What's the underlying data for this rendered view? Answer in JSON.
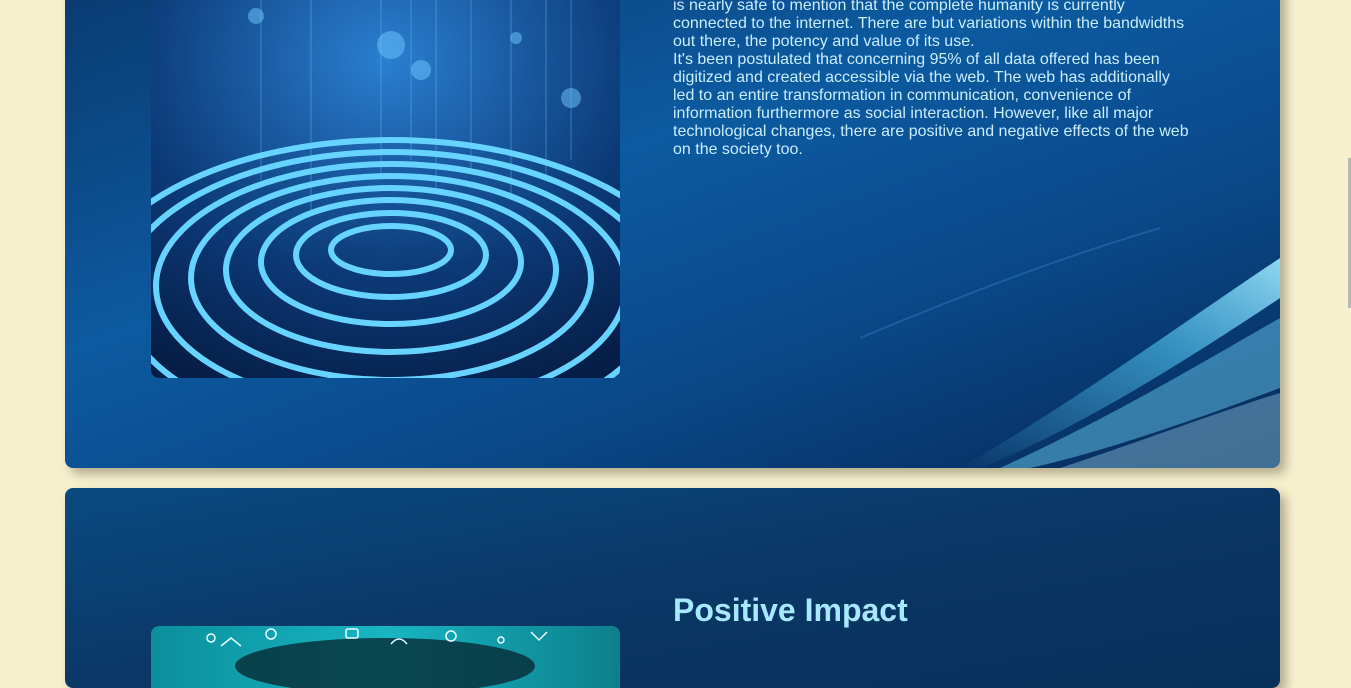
{
  "section_web": {
    "paragraph_1": "is nearly safe to mention that the complete humanity is currently connected to the internet. There are but variations within the bandwidths out there, the potency and value of its use.",
    "paragraph_2": "It's been postulated that concerning 95% of all data offered has been digitized and created accessible via the web. The web has additionally led to an entire transformation in communication, convenience of information furthermore as social interaction. However, like all major technological changes, there are positive and negative effects of the web on the society too.",
    "image_icon": "fingerprint-icon"
  },
  "section_positive": {
    "heading": "Positive Impact",
    "image_icon": "social-doodle-icon"
  },
  "colors": {
    "page_background": "#f6f0cf",
    "card_blue": "#0c5aa0",
    "text_light_blue": "#c9ecff",
    "heading_cyan": "#a8e8ff"
  }
}
